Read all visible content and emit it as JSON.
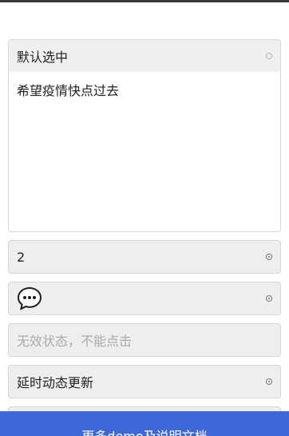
{
  "panel": {
    "title": "默认选中",
    "content": "希望疫情快点过去"
  },
  "rows": [
    {
      "label": "2"
    },
    {
      "label": "",
      "icon": "chat-bubble-icon"
    },
    {
      "label": "无效状态，不能点击",
      "disabled": true
    },
    {
      "label": "延时动态更新"
    }
  ],
  "footer": {
    "button_label": "更多demo及说明文档"
  }
}
